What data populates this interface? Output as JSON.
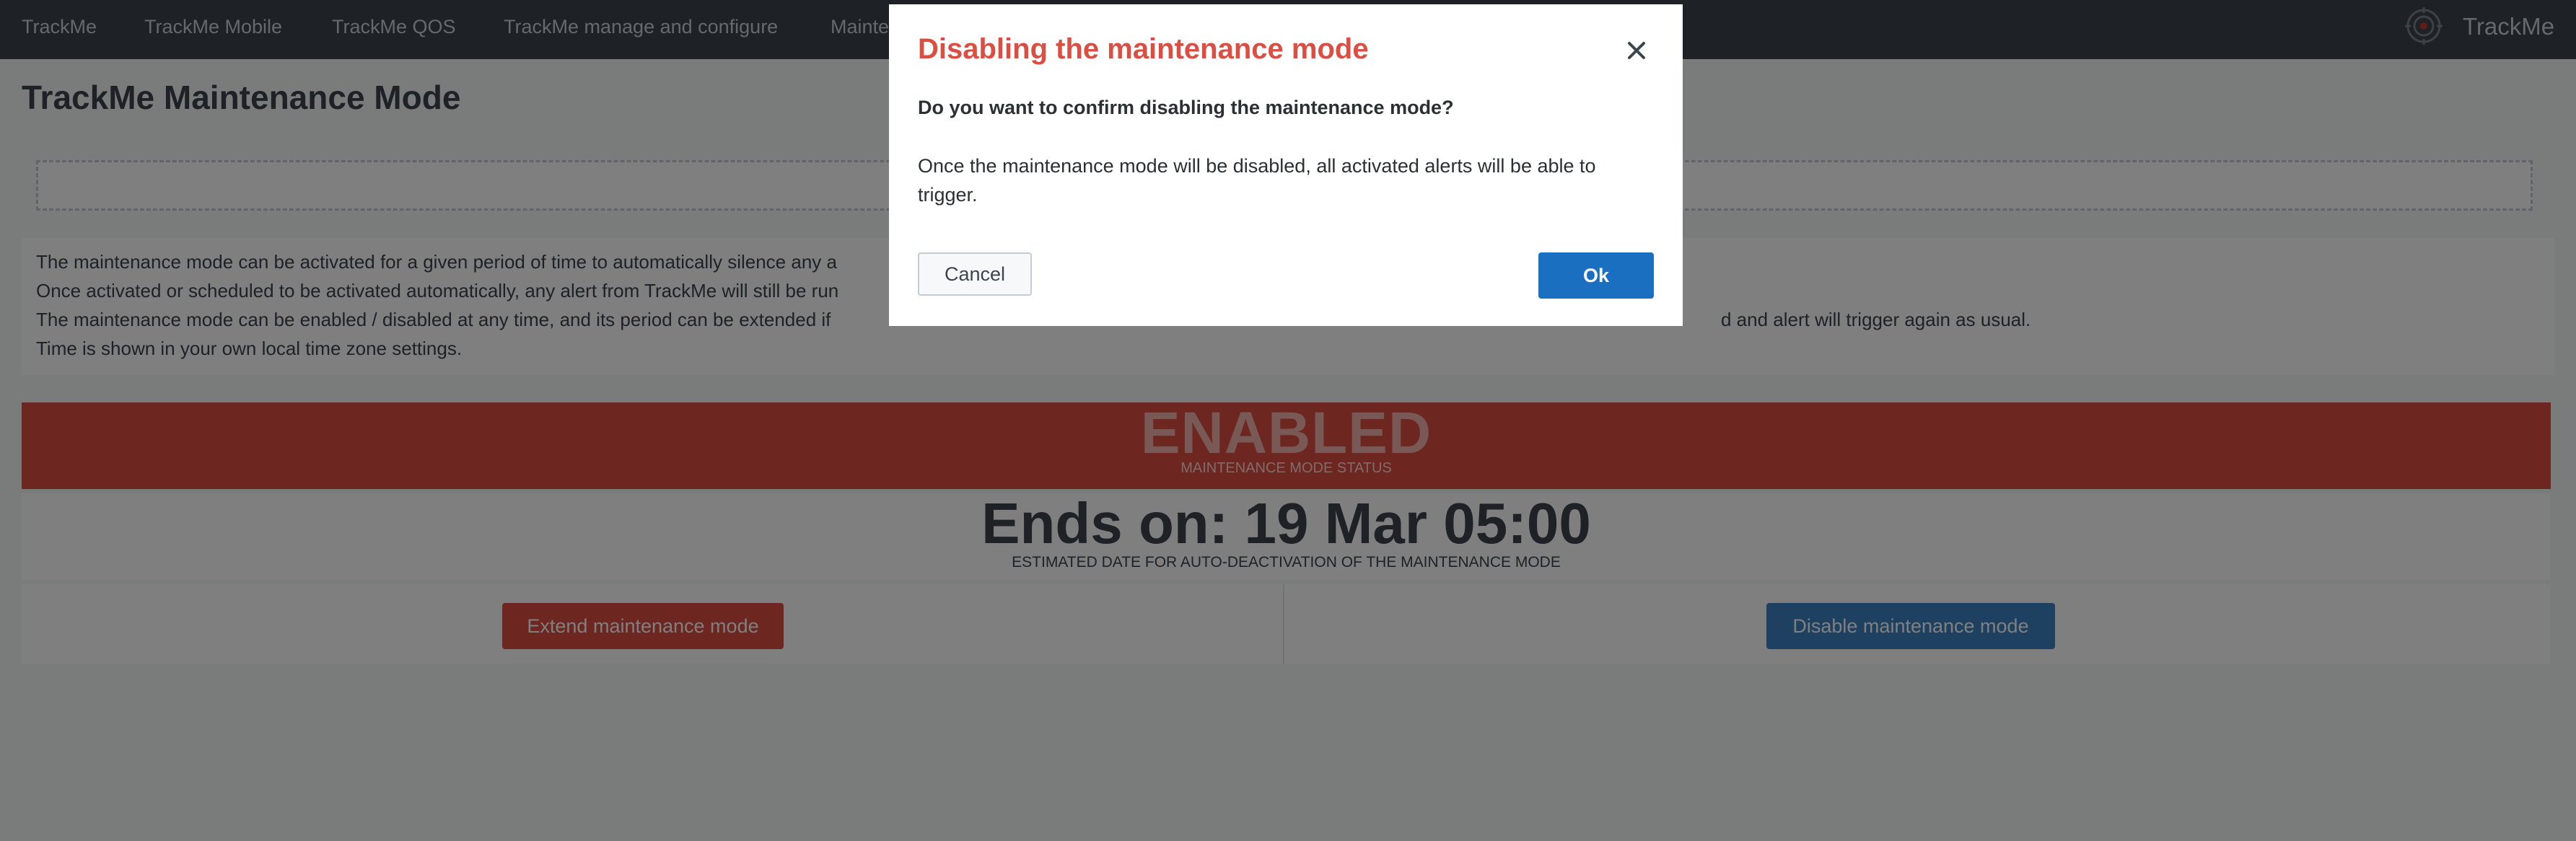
{
  "nav": {
    "items": [
      "TrackMe",
      "TrackMe Mobile",
      "TrackMe QOS",
      "TrackMe manage and configure",
      "Mainte"
    ],
    "brand": "TrackMe"
  },
  "page": {
    "title": "TrackMe Maintenance Mode"
  },
  "description": {
    "lines": [
      "The maintenance mode can be activated for a given period of time to automatically silence any a",
      "Once activated or scheduled to be activated automatically, any alert from TrackMe will still be run",
      "The maintenance mode can be enabled / disabled at any time, and its period can be extended if",
      "Time is shown in your own local time zone settings."
    ],
    "line3_tail": "d and alert will trigger again as usual."
  },
  "status": {
    "value": "ENABLED",
    "label": "MAINTENANCE MODE STATUS",
    "color": "#dc4e41"
  },
  "ends": {
    "value": "Ends on: 19 Mar 05:00",
    "label": "ESTIMATED DATE FOR AUTO-DEACTIVATION OF THE MAINTENANCE MODE"
  },
  "actions": {
    "extend_label": "Extend maintenance mode",
    "disable_label": "Disable maintenance mode"
  },
  "modal": {
    "title": "Disabling the maintenance mode",
    "question": "Do you want to confirm disabling the maintenance mode?",
    "body": "Once the maintenance mode will be disabled, all activated alerts will be able to trigger.",
    "cancel_label": "Cancel",
    "ok_label": "Ok",
    "title_color": "#dc4e41",
    "ok_color": "#1a6fc0"
  },
  "icons": {
    "close": "close-icon",
    "brand": "trackme-logo-icon"
  }
}
